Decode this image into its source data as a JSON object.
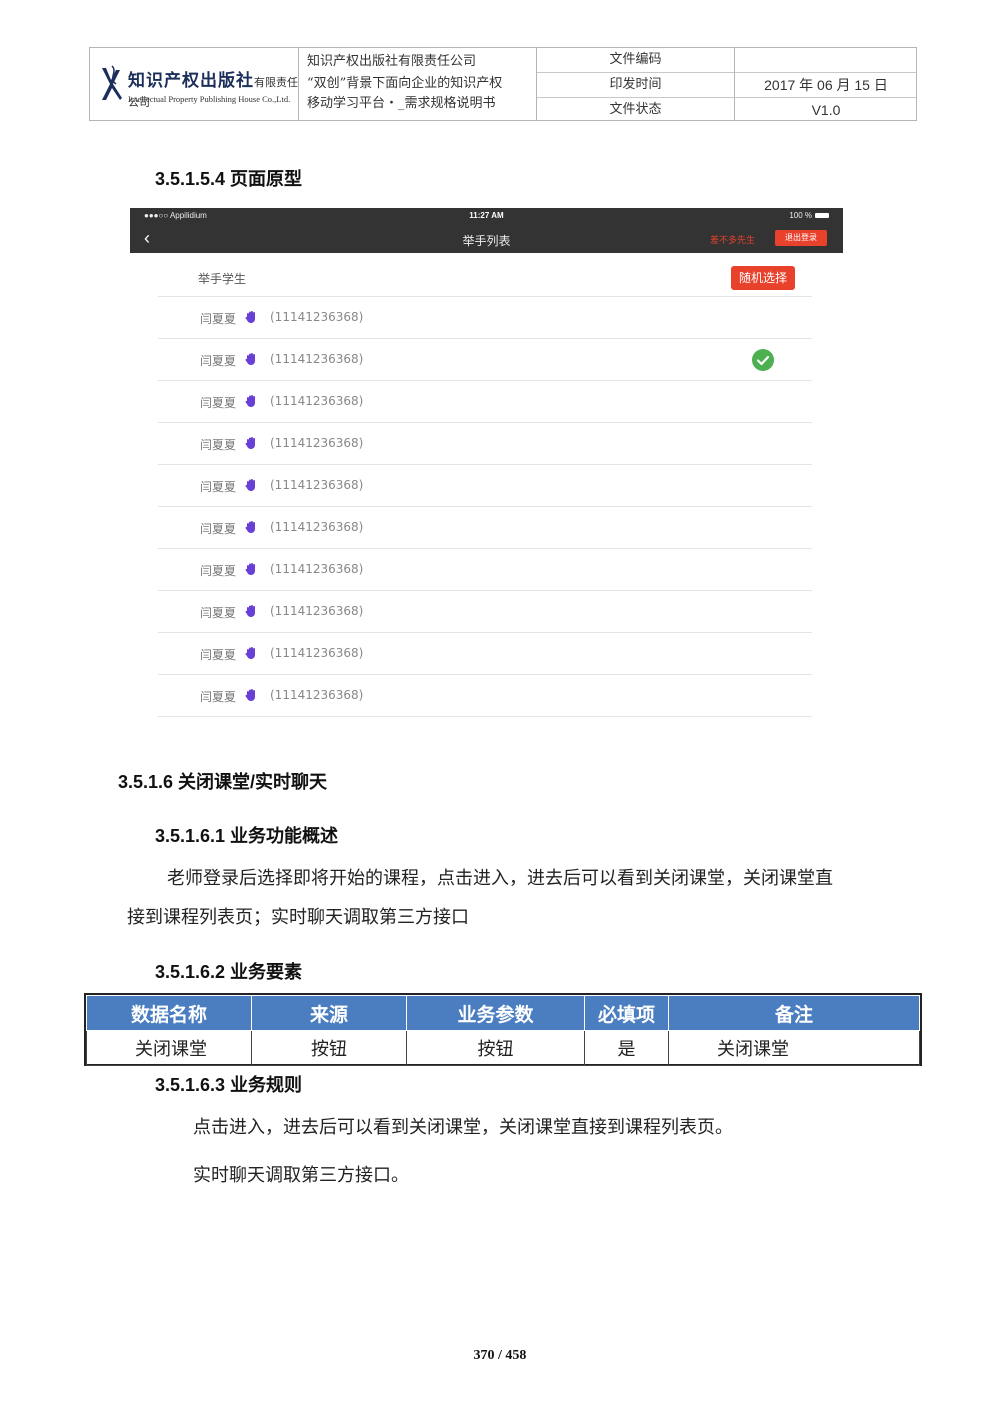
{
  "header": {
    "logo": {
      "name_cn": "知识产权出版社",
      "suffix": "有限责任公司",
      "name_en": "Intellectual Property Publishing House Co.,Ltd."
    },
    "company_lines": [
      "知识产权出版社有限责任公司",
      "“双创”背景下面向企业的知识产权",
      "移动学习平台・_需求规格说明书"
    ],
    "labels": [
      "文件编码",
      "印发时间",
      "文件状态"
    ],
    "values": [
      "",
      "2017 年 06 月 15 日",
      "V1.0"
    ]
  },
  "section_3_5_1_5_4": {
    "heading": "3.5.1.5.4 页面原型"
  },
  "mockup": {
    "status": {
      "carrier": "●●●○○ Appilidium",
      "time": "11:27 AM",
      "battery": "100 %"
    },
    "back_icon": "‹",
    "title": "举手列表",
    "user_name": "差不多先生",
    "logout_label": "退出登录",
    "list_header": "举手学生",
    "random_button": "随机选择",
    "rows": [
      {
        "name": "闫夏夏",
        "phone": "(11141236368)",
        "selected": false
      },
      {
        "name": "闫夏夏",
        "phone": "(11141236368)",
        "selected": true
      },
      {
        "name": "闫夏夏",
        "phone": "(11141236368)",
        "selected": false
      },
      {
        "name": "闫夏夏",
        "phone": "(11141236368)",
        "selected": false
      },
      {
        "name": "闫夏夏",
        "phone": "(11141236368)",
        "selected": false
      },
      {
        "name": "闫夏夏",
        "phone": "(11141236368)",
        "selected": false
      },
      {
        "name": "闫夏夏",
        "phone": "(11141236368)",
        "selected": false
      },
      {
        "name": "闫夏夏",
        "phone": "(11141236368)",
        "selected": false
      },
      {
        "name": "闫夏夏",
        "phone": "(11141236368)",
        "selected": false
      },
      {
        "name": "闫夏夏",
        "phone": "(11141236368)",
        "selected": false
      }
    ],
    "hand_color": "#6a3fd6",
    "check_color": "#4caf50"
  },
  "section_3_5_1_6": {
    "heading": "3.5.1.6 关闭课堂/实时聊天"
  },
  "section_3_5_1_6_1": {
    "heading": "3.5.1.6.1 业务功能概述",
    "line1": "老师登录后选择即将开始的课程，点击进入，进去后可以看到关闭课堂，关闭课堂直",
    "line2": "接到课程列表页；实时聊天调取第三方接口"
  },
  "section_3_5_1_6_2": {
    "heading": "3.5.1.6.2 业务要素",
    "columns": [
      "数据名称",
      "来源",
      "业务参数",
      "必填项",
      "备注"
    ],
    "rows": [
      [
        "关闭课堂",
        "按钮",
        "按钮",
        "是",
        "关闭课堂"
      ]
    ]
  },
  "section_3_5_1_6_3": {
    "heading": "3.5.1.6.3 业务规则",
    "line1": "点击进入，进去后可以看到关闭课堂，关闭课堂直接到课程列表页。",
    "line2": "实时聊天调取第三方接口。"
  },
  "footer": {
    "page": "370 / 458"
  },
  "colors": {
    "accent_red": "#e8412c",
    "table_header_blue": "#4a7ec0",
    "navbar": "#333333"
  }
}
